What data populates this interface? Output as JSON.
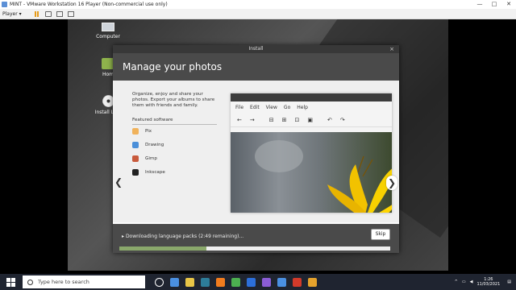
{
  "vm": {
    "title": "MINT - VMware Workstation 16 Player (Non-commercial use only)",
    "menu_player": "Player",
    "minimize": "—",
    "maximize": "□",
    "close": "✕"
  },
  "desktop": {
    "icons": [
      {
        "label": "Computer"
      },
      {
        "label": "Hom"
      },
      {
        "label": "Install Linu"
      }
    ]
  },
  "installer": {
    "window_title": "Install",
    "close": "×",
    "header": "Manage your photos",
    "description": "Organize, enjoy and share your photos. Export your albums to share them with friends and family.",
    "featured_label": "Featured software",
    "software": [
      {
        "name": "Pix",
        "color": "#f0b25b"
      },
      {
        "name": "Drawing",
        "color": "#4a8fd9"
      },
      {
        "name": "Gimp",
        "color": "#c85a3c"
      },
      {
        "name": "Inkscape",
        "color": "#222222"
      }
    ],
    "screenshot_menu": [
      "File",
      "Edit",
      "View",
      "Go",
      "Help"
    ],
    "screenshot_toolbar": [
      "←",
      "→",
      "⊟",
      "⊞",
      "⊡",
      "▣",
      "↶",
      "↷"
    ],
    "status": "Downloading language packs (2:49 remaining)...",
    "skip_label": "Skip",
    "progress": 0.32,
    "nav_prev": "❮",
    "nav_next": "❯"
  },
  "taskbar": {
    "search_placeholder": "Type here to search",
    "time": "1:26",
    "date": "11/03/2021",
    "app_colors": [
      "#ffffff",
      "#4a90e2",
      "#e8c547",
      "#2d7d9a",
      "#f27c1e",
      "#4caf50",
      "#2c6fdb",
      "#8a5cd6",
      "#4a90e2",
      "#d23a2a",
      "#e5a22c"
    ]
  }
}
